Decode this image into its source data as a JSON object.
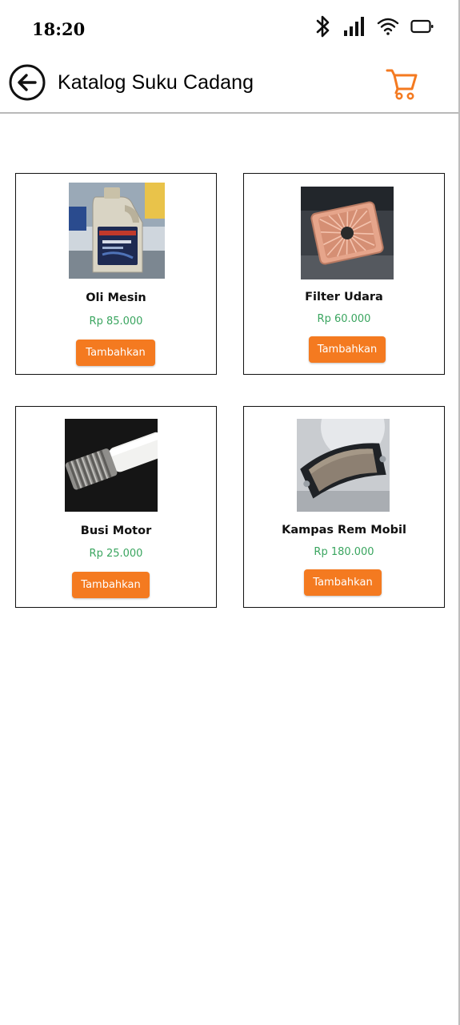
{
  "status_bar": {
    "time": "18:20",
    "icons": [
      "bluetooth-icon",
      "signal-icon",
      "wifi-icon",
      "battery-icon"
    ]
  },
  "app_bar": {
    "title": "Katalog Suku Cadang",
    "back_icon": "arrow-left-circle-icon",
    "cart_icon": "shopping-cart-icon"
  },
  "colors": {
    "accent": "#f47a20",
    "price": "#3aa55f",
    "cart": "#f47a20"
  },
  "products": [
    {
      "name": "Oli Mesin",
      "price": "Rp 85.000",
      "button": "Tambahkan",
      "image": "engine-oil-bottle-image"
    },
    {
      "name": "Filter Udara",
      "price": "Rp 60.000",
      "button": "Tambahkan",
      "image": "air-filter-image"
    },
    {
      "name": "Busi Motor",
      "price": "Rp 25.000",
      "button": "Tambahkan",
      "image": "spark-plug-image"
    },
    {
      "name": "Kampas Rem Mobil",
      "price": "Rp 180.000",
      "button": "Tambahkan",
      "image": "brake-pad-image"
    }
  ]
}
